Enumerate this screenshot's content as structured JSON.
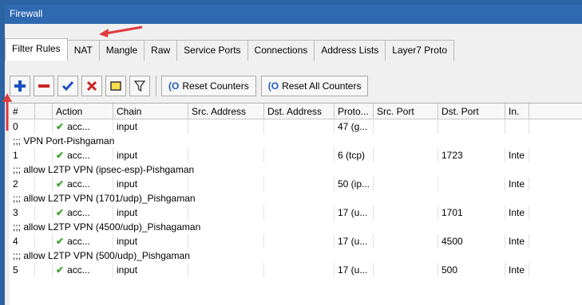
{
  "window": {
    "title": "Firewall"
  },
  "tabs": [
    "Filter Rules",
    "NAT",
    "Mangle",
    "Raw",
    "Service Ports",
    "Connections",
    "Address Lists",
    "Layer7 Proto"
  ],
  "toolbar": {
    "add_icon": "plus-icon",
    "remove_icon": "minus-icon",
    "enable_icon": "check-icon",
    "disable_icon": "x-icon",
    "comment_icon": "note-icon",
    "filter_icon": "filter-icon",
    "reset_counters": "Reset Counters",
    "reset_all_counters": "Reset All Counters"
  },
  "table": {
    "columns": [
      "#",
      "Action",
      "Chain",
      "Src. Address",
      "Dst. Address",
      "Proto...",
      "Src. Port",
      "Dst. Port",
      "In."
    ],
    "rows": [
      {
        "type": "rule",
        "num": "0",
        "action": "acc...",
        "chain": "input",
        "src": "",
        "dst": "",
        "proto": "47 (g...",
        "sport": "",
        "dport": "",
        "in": ""
      },
      {
        "type": "comment",
        "text": ";;; VPN Port-Pishgaman"
      },
      {
        "type": "rule",
        "num": "1",
        "action": "acc...",
        "chain": "input",
        "src": "",
        "dst": "",
        "proto": "6 (tcp)",
        "sport": "",
        "dport": "1723",
        "in": "Inte"
      },
      {
        "type": "comment",
        "text": ";;; allow L2TP VPN (ipsec-esp)-Pishgaman"
      },
      {
        "type": "rule",
        "num": "2",
        "action": "acc...",
        "chain": "input",
        "src": "",
        "dst": "",
        "proto": "50 (ip...",
        "sport": "",
        "dport": "",
        "in": "Inte"
      },
      {
        "type": "comment",
        "text": ";;; allow L2TP VPN (1701/udp)_Pishgaman"
      },
      {
        "type": "rule",
        "num": "3",
        "action": "acc...",
        "chain": "input",
        "src": "",
        "dst": "",
        "proto": "17 (u...",
        "sport": "",
        "dport": "1701",
        "in": "Inte"
      },
      {
        "type": "comment",
        "text": ";;; allow L2TP VPN (4500/udp)_Pishagaman"
      },
      {
        "type": "rule",
        "num": "4",
        "action": "acc...",
        "chain": "input",
        "src": "",
        "dst": "",
        "proto": "17 (u...",
        "sport": "",
        "dport": "4500",
        "in": "Inte"
      },
      {
        "type": "comment",
        "text": ";;; allow L2TP VPN (500/udp)_Pishgaman"
      },
      {
        "type": "rule",
        "num": "5",
        "action": "acc...",
        "chain": "input",
        "src": "",
        "dst": "",
        "proto": "17 (u...",
        "sport": "",
        "dport": "500",
        "in": "Inte"
      }
    ]
  },
  "colors": {
    "title_bar": "#2f69b0",
    "annotation_arrow": "#e0393e",
    "accept_check": "#3aa52a",
    "add_plus": "#1f4fc0",
    "remove_minus": "#cc2222"
  }
}
